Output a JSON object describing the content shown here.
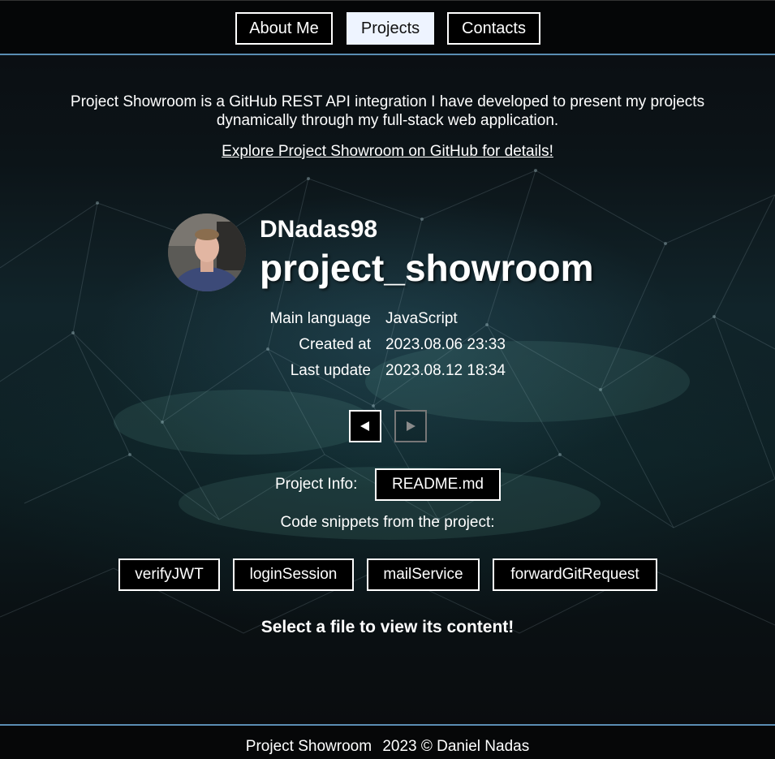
{
  "nav": {
    "items": [
      {
        "label": "About Me",
        "active": false
      },
      {
        "label": "Projects",
        "active": true
      },
      {
        "label": "Contacts",
        "active": false
      }
    ]
  },
  "intro": {
    "text": "Project Showroom is a GitHub REST API integration I have developed to present my projects dynamically through my full-stack web application.",
    "link": "Explore Project Showroom on GitHub for details!"
  },
  "project": {
    "owner": "DNadas98",
    "name": "project_showroom",
    "details": [
      {
        "key": "Main language",
        "value": "JavaScript"
      },
      {
        "key": "Created at",
        "value": "2023.08.06 23:33"
      },
      {
        "key": "Last update",
        "value": "2023.08.12 18:34"
      }
    ]
  },
  "pager": {
    "prev_icon": "triangle-left-icon",
    "next_icon": "triangle-right-icon",
    "next_enabled": false
  },
  "info": {
    "label": "Project Info:",
    "readme": "README.md"
  },
  "snippets": {
    "label": "Code snippets from the project:",
    "files": [
      "verifyJWT",
      "loginSession",
      "mailService",
      "forwardGitRequest"
    ],
    "message": "Select a file to view its content!"
  },
  "footer": {
    "title": "Project Showroom",
    "copyright": "2023 © Daniel Nadas"
  },
  "colors": {
    "accent_border": "#5a8db3",
    "active_nav_bg": "#eef4ff",
    "button_bg": "#000000",
    "text": "#ffffff"
  }
}
